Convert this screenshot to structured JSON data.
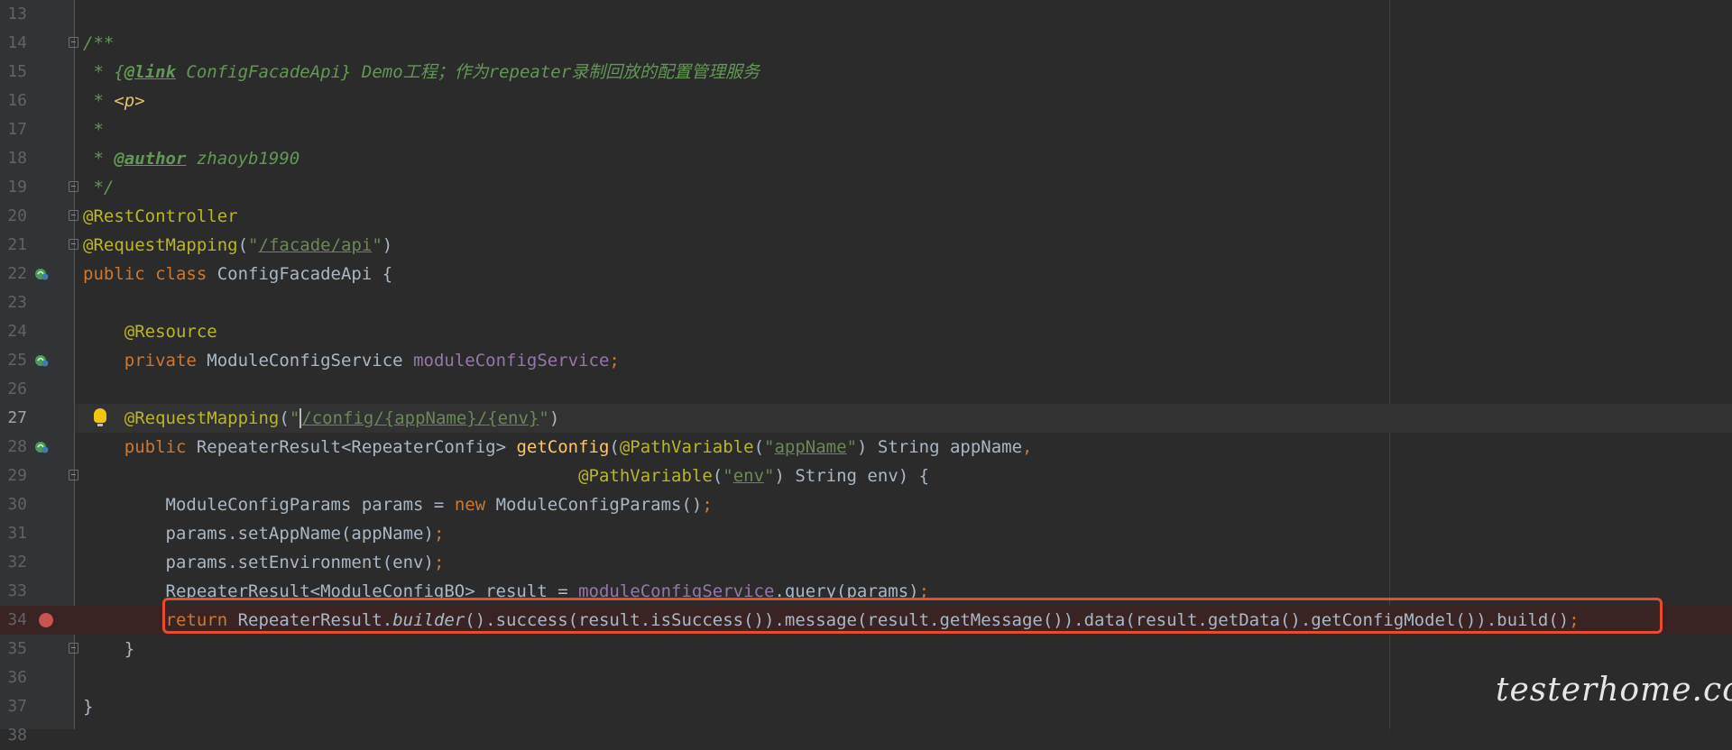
{
  "editor": {
    "lines": [
      {
        "num": "13"
      },
      {
        "num": "14",
        "segments": [
          {
            "t": "/**",
            "c": "doc"
          }
        ]
      },
      {
        "num": "15",
        "segments": [
          {
            "t": " * ",
            "c": "doc"
          },
          {
            "t": "{",
            "c": "doc"
          },
          {
            "t": "@link",
            "c": "doc-tag"
          },
          {
            "t": " ConfigFacadeApi",
            "c": "doc"
          },
          {
            "t": "} Demo工程；作为repeater录制回放的配置管理服务",
            "c": "doc"
          }
        ]
      },
      {
        "num": "16",
        "segments": [
          {
            "t": " * ",
            "c": "doc"
          },
          {
            "t": "<p>",
            "c": "doc-html"
          }
        ]
      },
      {
        "num": "17",
        "segments": [
          {
            "t": " *",
            "c": "doc"
          }
        ]
      },
      {
        "num": "18",
        "segments": [
          {
            "t": " * ",
            "c": "doc"
          },
          {
            "t": "@author",
            "c": "doc-tag"
          },
          {
            "t": " zhaoyb1990",
            "c": "doc"
          }
        ]
      },
      {
        "num": "19",
        "segments": [
          {
            "t": " */",
            "c": "doc"
          }
        ]
      },
      {
        "num": "20",
        "segments": [
          {
            "t": "@RestController",
            "c": "ann"
          }
        ]
      },
      {
        "num": "21",
        "segments": [
          {
            "t": "@RequestMapping",
            "c": "ann"
          },
          {
            "t": "(",
            "c": ""
          },
          {
            "t": "\"",
            "c": "str"
          },
          {
            "t": "/facade/api",
            "c": "str-u"
          },
          {
            "t": "\"",
            "c": "str"
          },
          {
            "t": ")",
            "c": ""
          }
        ]
      },
      {
        "num": "22",
        "segments": [
          {
            "t": "public class ",
            "c": "kw"
          },
          {
            "t": "ConfigFacadeApi {",
            "c": ""
          }
        ]
      },
      {
        "num": "23"
      },
      {
        "num": "24",
        "segments": [
          {
            "t": "    ",
            "c": ""
          },
          {
            "t": "@Resource",
            "c": "ann"
          }
        ]
      },
      {
        "num": "25",
        "segments": [
          {
            "t": "    ",
            "c": ""
          },
          {
            "t": "private ",
            "c": "kw"
          },
          {
            "t": "ModuleConfigService ",
            "c": ""
          },
          {
            "t": "moduleConfigService",
            "c": "field"
          },
          {
            "t": ";",
            "c": "kw"
          }
        ]
      },
      {
        "num": "26"
      },
      {
        "num": "27",
        "segments": [
          {
            "t": "    ",
            "c": ""
          },
          {
            "t": "@RequestMapping",
            "c": "ann"
          },
          {
            "t": "(",
            "c": ""
          },
          {
            "t": "\"",
            "c": "str"
          },
          {
            "t": "/config/{appName}/{env}",
            "c": "str-u",
            "caret": true
          },
          {
            "t": "\"",
            "c": "str"
          },
          {
            "t": ")",
            "c": ""
          }
        ]
      },
      {
        "num": "28",
        "segments": [
          {
            "t": "    ",
            "c": ""
          },
          {
            "t": "public ",
            "c": "kw"
          },
          {
            "t": "RepeaterResult<RepeaterConfig> ",
            "c": ""
          },
          {
            "t": "getConfig",
            "c": "mth"
          },
          {
            "t": "(",
            "c": ""
          },
          {
            "t": "@PathVariable",
            "c": "ann"
          },
          {
            "t": "(",
            "c": ""
          },
          {
            "t": "\"",
            "c": "str"
          },
          {
            "t": "appName",
            "c": "str-u"
          },
          {
            "t": "\"",
            "c": "str"
          },
          {
            "t": ") String appName",
            "c": ""
          },
          {
            "t": ",",
            "c": "kw"
          }
        ]
      },
      {
        "num": "29",
        "segments": [
          {
            "t": "                                                ",
            "c": ""
          },
          {
            "t": "@PathVariable",
            "c": "ann"
          },
          {
            "t": "(",
            "c": ""
          },
          {
            "t": "\"",
            "c": "str"
          },
          {
            "t": "env",
            "c": "str-u"
          },
          {
            "t": "\"",
            "c": "str"
          },
          {
            "t": ") String env) {",
            "c": ""
          }
        ]
      },
      {
        "num": "30",
        "segments": [
          {
            "t": "        ModuleConfigParams params = ",
            "c": ""
          },
          {
            "t": "new ",
            "c": "kw"
          },
          {
            "t": "ModuleConfigParams()",
            "c": ""
          },
          {
            "t": ";",
            "c": "kw"
          }
        ]
      },
      {
        "num": "31",
        "segments": [
          {
            "t": "        params.setAppName(appName)",
            "c": ""
          },
          {
            "t": ";",
            "c": "kw"
          }
        ]
      },
      {
        "num": "32",
        "segments": [
          {
            "t": "        params.setEnvironment(env)",
            "c": ""
          },
          {
            "t": ";",
            "c": "kw"
          }
        ]
      },
      {
        "num": "33",
        "segments": [
          {
            "t": "        RepeaterResult<ModuleConfigBO> result = ",
            "c": ""
          },
          {
            "t": "moduleConfigService",
            "c": "field"
          },
          {
            "t": ".query(params)",
            "c": ""
          },
          {
            "t": ";",
            "c": "kw"
          }
        ]
      },
      {
        "num": "34",
        "segments": [
          {
            "t": "        ",
            "c": ""
          },
          {
            "t": "return ",
            "c": "kw"
          },
          {
            "t": "RepeaterResult.",
            "c": ""
          },
          {
            "t": "builder",
            "c": "static"
          },
          {
            "t": "().success(result.isSuccess()).message(result.getMessage()).data(result.getData().getConfigModel()).build()",
            "c": ""
          },
          {
            "t": ";",
            "c": "kw"
          }
        ]
      },
      {
        "num": "35",
        "segments": [
          {
            "t": "    }",
            "c": ""
          }
        ]
      },
      {
        "num": "36"
      },
      {
        "num": "37",
        "segments": [
          {
            "t": "}",
            "c": ""
          }
        ]
      },
      {
        "num": "38"
      }
    ]
  },
  "gutter_markers": {
    "22": "spring-bean-icon",
    "25": "spring-inject-icon",
    "28": "spring-web-icon",
    "34": "breakpoint-icon"
  },
  "fold_lines": [
    "14",
    "19",
    "20",
    "21",
    "29",
    "35"
  ],
  "active_line": "27",
  "highlight_line": "34",
  "watermark": "testerhome.com",
  "colors": {
    "background": "#2b2b2b",
    "gutter": "#313335",
    "keyword": "#cc7832",
    "annotation": "#bbb529",
    "string": "#6a8759",
    "field": "#9876aa",
    "method": "#ffc66d",
    "doc": "#629755",
    "breakpoint": "#c75450",
    "highlight_border": "#e74c2c"
  }
}
